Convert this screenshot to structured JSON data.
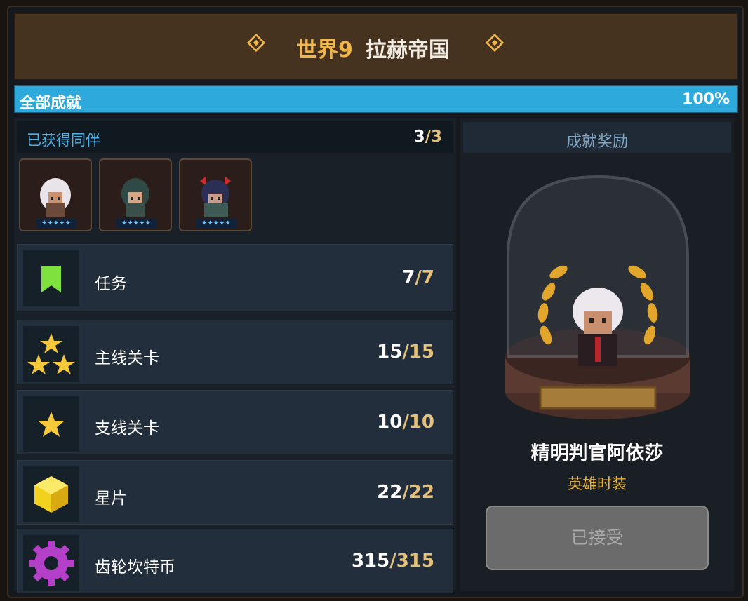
{
  "header": {
    "world": "世界9",
    "region": "拉赫帝国"
  },
  "progress": {
    "label": "全部成就",
    "percent_text": "100%",
    "fraction": 1.0
  },
  "companions": {
    "title": "已获得同伴",
    "count": "3",
    "total": "3",
    "heroes": [
      {
        "stars": "✦✦✦✦✦"
      },
      {
        "stars": "✦✦✦✦✦"
      },
      {
        "stars": "✦✦✦✦✦"
      }
    ]
  },
  "achievements": [
    {
      "icon": "bookmark-icon",
      "label": "任务",
      "done": "7",
      "total": "7"
    },
    {
      "icon": "three-stars-icon",
      "label": "主线关卡",
      "done": "15",
      "total": "15"
    },
    {
      "icon": "star-icon",
      "label": "支线关卡",
      "done": "10",
      "total": "10"
    },
    {
      "icon": "star-piece-cube-icon",
      "label": "星片",
      "done": "22",
      "total": "22"
    },
    {
      "icon": "gear-coin-icon",
      "label": "齿轮坎特币",
      "done": "315",
      "total": "315"
    }
  ],
  "reward": {
    "title": "成就奖励",
    "name": "精明判官阿依莎",
    "type": "英雄时装",
    "button_label": "已接受"
  },
  "colors": {
    "accent_gold": "#f0b64a",
    "progress_blue": "#2ea9dc",
    "icon_green": "#7ee13e",
    "reward_type_gold": "#e8b43a"
  }
}
